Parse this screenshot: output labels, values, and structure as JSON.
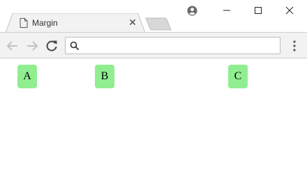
{
  "window": {
    "tab": {
      "title": "Margin"
    }
  },
  "toolbar": {
    "address": {
      "value": "",
      "placeholder": ""
    }
  },
  "icons": {
    "page": "page-icon",
    "close_tab": "close-icon",
    "account": "account-icon",
    "minimize": "minimize-icon",
    "maximize": "maximize-icon",
    "close_window": "close-icon",
    "back": "arrow-left-icon",
    "forward": "arrow-right-icon",
    "reload": "reload-icon",
    "search": "search-icon",
    "menu": "more-vertical-icon"
  },
  "page": {
    "boxes": [
      "A",
      "B",
      "C"
    ]
  },
  "colors": {
    "box_fill": "#90ee90",
    "toolbar": "#f2f2f2",
    "tab": "#f2f2f2"
  }
}
